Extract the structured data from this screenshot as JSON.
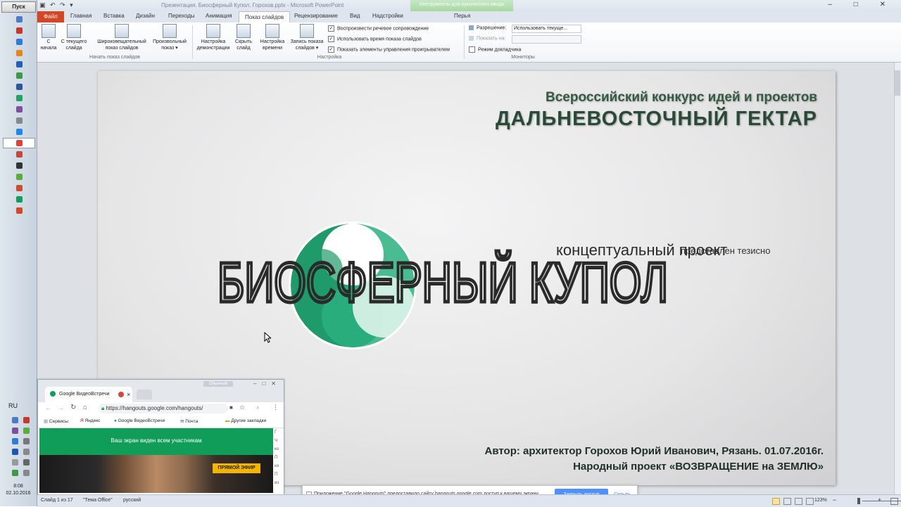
{
  "taskbar": {
    "start_label": "Пуск",
    "lang": "RU",
    "clock_time": "8:08",
    "clock_date": "02.10.2016",
    "app_icons": [
      "browser-icon",
      "folder-icon",
      "skype-icon",
      "firefox-icon",
      "outlook-icon",
      "maps-icon",
      "word-icon",
      "sheets-icon",
      "viber-icon",
      "tool-icon",
      "ie-icon",
      "chrome-icon",
      "mail-icon",
      "media-icon",
      "torrent-icon",
      "chart-icon",
      "hangouts-icon",
      "powerpoint-icon"
    ],
    "colors": [
      "#4a7bc8",
      "#c23a2b",
      "#2f7bd8",
      "#e88420",
      "#2160b4",
      "#3a9a48",
      "#2b579a",
      "#21a366",
      "#7b519d",
      "#888888",
      "#1e88e5",
      "#db4437",
      "#c2483a",
      "#333333",
      "#5cab3d",
      "#c94f2a",
      "#0f9d58",
      "#d24726"
    ]
  },
  "titlebar": {
    "quick_access": "▣ ↶ ↷ ▾",
    "window_title": "Презентация. Биосферный Купол. Горохов.pptx  -  Microsoft PowerPoint",
    "context_tab_group": "Инструменты для рукописного ввода",
    "window_controls": "‒ □ ✕"
  },
  "ribbon_tabs": {
    "file": "Файл",
    "home": "Главная",
    "insert": "Вставка",
    "design": "Дизайн",
    "transitions": "Переходы",
    "animation": "Анимация",
    "slideshow": "Показ слайдов",
    "review": "Рецензирование",
    "view": "Вид",
    "settings": "Надстройки",
    "pens": "Перья"
  },
  "ribbon": {
    "from_start": [
      "С",
      "начала"
    ],
    "from_current": [
      "С текущего",
      "слайда"
    ],
    "broadcast": [
      "Широковещательный",
      "показ слайдов"
    ],
    "custom_show": [
      "Произвольный",
      "показ ▾"
    ],
    "group_start": "Начать показ слайдов",
    "setup_show": [
      "Настройка",
      "демонстрации"
    ],
    "hide_slide": [
      "Скрыть",
      "слайд"
    ],
    "rehearse": [
      "Настройка",
      "времени"
    ],
    "record": [
      "Запись показа",
      "слайдов ▾"
    ],
    "chk_narration": "Воспроизвести речевое сопровождение",
    "chk_timings": "Использовать время показа слайдов",
    "chk_controls": "Показать элементы управления проигрывателем",
    "group_setup": "Настройка",
    "resolution_label": "Разрешение:",
    "resolution_value": "Использовать текуще...",
    "show_on_label": "Показать на:",
    "presenter_view": "Режим докладчика",
    "group_monitors": "Мониторы"
  },
  "slide": {
    "heading1": "Всероссийский конкурс идей и проектов",
    "heading2": "ДАЛЬНЕВОСТОЧНЫЙ ГЕКТАР",
    "logo_main": "БИОСФЕРНЫЙ КУПОЛ",
    "logo_sub": "концептуальный проект",
    "logo_note": "представлен тезисно",
    "author_line1": "Автор: архитектор Горохов Юрий Иванович, Рязань. 01.07.2016г.",
    "author_line2": "Народный проект «ВОЗВРАЩЕНИЕ на ЗЕМЛЮ»",
    "accent": "#1f9a6a"
  },
  "hangouts": {
    "tab_title": "Google ВидеоВстречи",
    "badge": "Обычный",
    "url": "https://hangouts.google.com/hangouts/",
    "bookmarks": [
      "Сервисы",
      "Яндекс",
      "Google ВидеоВстречи",
      "Почта"
    ],
    "other_bookmarks": "Другие закладки",
    "banner": "Ваш экран виден всем участникам",
    "live": "ПРЯМОЙ ЭФИР",
    "side_text": "Г\nЧ\nко\nП\nко\nП\nиз"
  },
  "notification": {
    "text": "Приложение \"Google Hangouts\" предоставило сайту hangouts.google.com доступ к вашему экрану.",
    "stop_button": "Закрыть доступ",
    "hide_link": "Скрыть"
  },
  "statusbar": {
    "slide_of": "Слайд 1 из 17",
    "theme": "\"Тема Office\"",
    "language": "русский",
    "zoom": "123%"
  }
}
